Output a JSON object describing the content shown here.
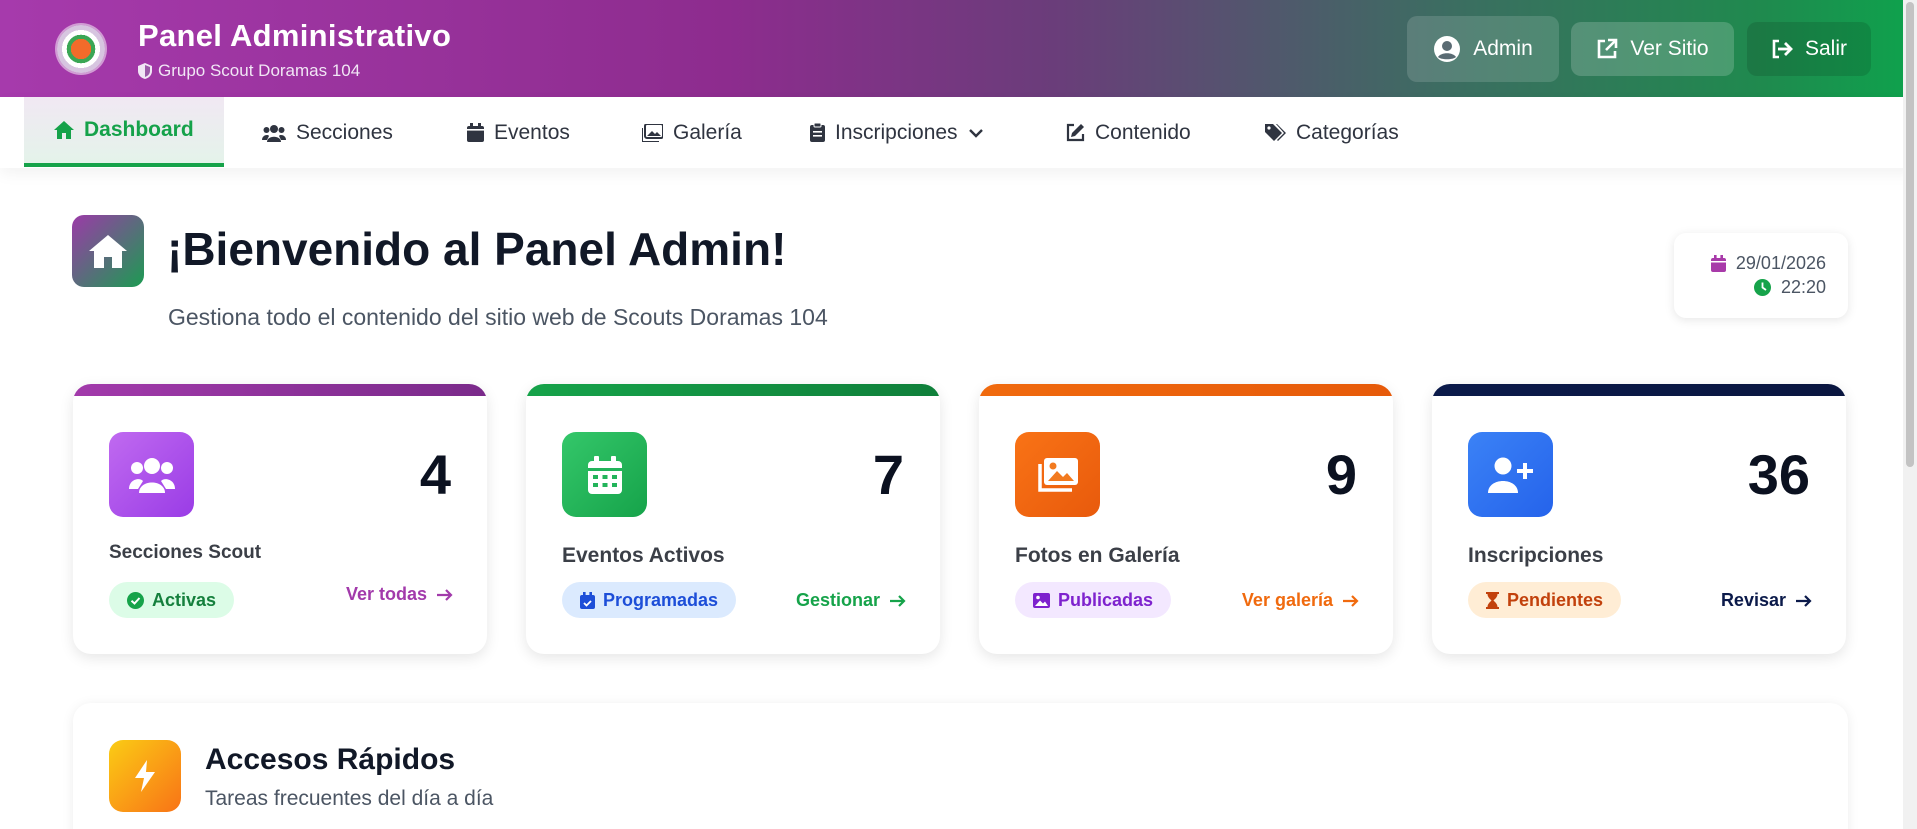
{
  "header": {
    "title": "Panel Administrativo",
    "subtitle": "Grupo Scout Doramas 104",
    "buttons": {
      "admin": "Admin",
      "ver_sitio": "Ver Sitio",
      "salir": "Salir"
    }
  },
  "nav": {
    "items": [
      {
        "label": "Dashboard",
        "icon": "home-icon",
        "active": true
      },
      {
        "label": "Secciones",
        "icon": "users-icon"
      },
      {
        "label": "Eventos",
        "icon": "calendar-icon"
      },
      {
        "label": "Galería",
        "icon": "images-icon"
      },
      {
        "label": "Inscripciones",
        "icon": "clipboard-icon",
        "dropdown": true
      },
      {
        "label": "Contenido",
        "icon": "edit-icon"
      },
      {
        "label": "Categorías",
        "icon": "tags-icon"
      }
    ]
  },
  "welcome": {
    "title": "¡Bienvenido al Panel Admin!",
    "subtitle": "Gestiona todo el contenido del sitio web de Scouts Doramas 104",
    "date": "29/01/2026",
    "time": "22:20"
  },
  "cards": [
    {
      "value": "4",
      "label": "Secciones Scout",
      "pill": "Activas",
      "link": "Ver todas",
      "color": "#a64ac9"
    },
    {
      "value": "7",
      "label": "Eventos Activos",
      "pill": "Programadas",
      "link": "Gestionar",
      "color": "#16a34a"
    },
    {
      "value": "9",
      "label": "Fotos en Galería",
      "pill": "Publicadas",
      "link": "Ver galería",
      "color": "#f06a0e"
    },
    {
      "value": "36",
      "label": "Inscripciones",
      "pill": "Pendientes",
      "link": "Revisar",
      "color": "#0b1a4a"
    }
  ],
  "quick": {
    "title": "Accesos Rápidos",
    "subtitle": "Tareas frecuentes del día a día"
  }
}
